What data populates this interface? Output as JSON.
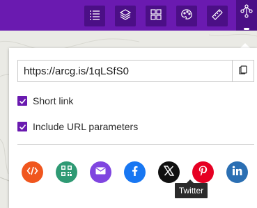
{
  "toolbar": {
    "buttons": [
      {
        "icon": "legend-list-icon"
      },
      {
        "icon": "layers-icon"
      },
      {
        "icon": "basemap-gallery-icon"
      },
      {
        "icon": "palette-icon"
      },
      {
        "icon": "measure-ruler-icon"
      },
      {
        "icon": "share-icon",
        "active": true
      }
    ],
    "color": "#6a1ab0",
    "button_color": "#4b0f86"
  },
  "share_panel": {
    "url_value": "https://arcg.is/1qLSfS0",
    "copy_icon": "copy-icon",
    "short_link_label": "Short link",
    "short_link_checked": true,
    "url_params_label": "Include URL parameters",
    "url_params_checked": true,
    "social": [
      {
        "name": "embed",
        "icon": "code-embed-icon",
        "color": "#f0561e"
      },
      {
        "name": "qr",
        "icon": "qr-code-icon",
        "color": "#2f9a74"
      },
      {
        "name": "email",
        "icon": "mail-icon",
        "color": "#7f45e0"
      },
      {
        "name": "facebook",
        "icon": "facebook-icon",
        "color": "#1877f2"
      },
      {
        "name": "x",
        "icon": "x-twitter-icon",
        "color": "#111111"
      },
      {
        "name": "pinterest",
        "icon": "pinterest-icon",
        "color": "#e60023"
      },
      {
        "name": "linkedin",
        "icon": "linkedin-icon",
        "color": "#2b6fb3"
      }
    ],
    "tooltip": "Twitter",
    "accent": "#6a1ab0"
  }
}
